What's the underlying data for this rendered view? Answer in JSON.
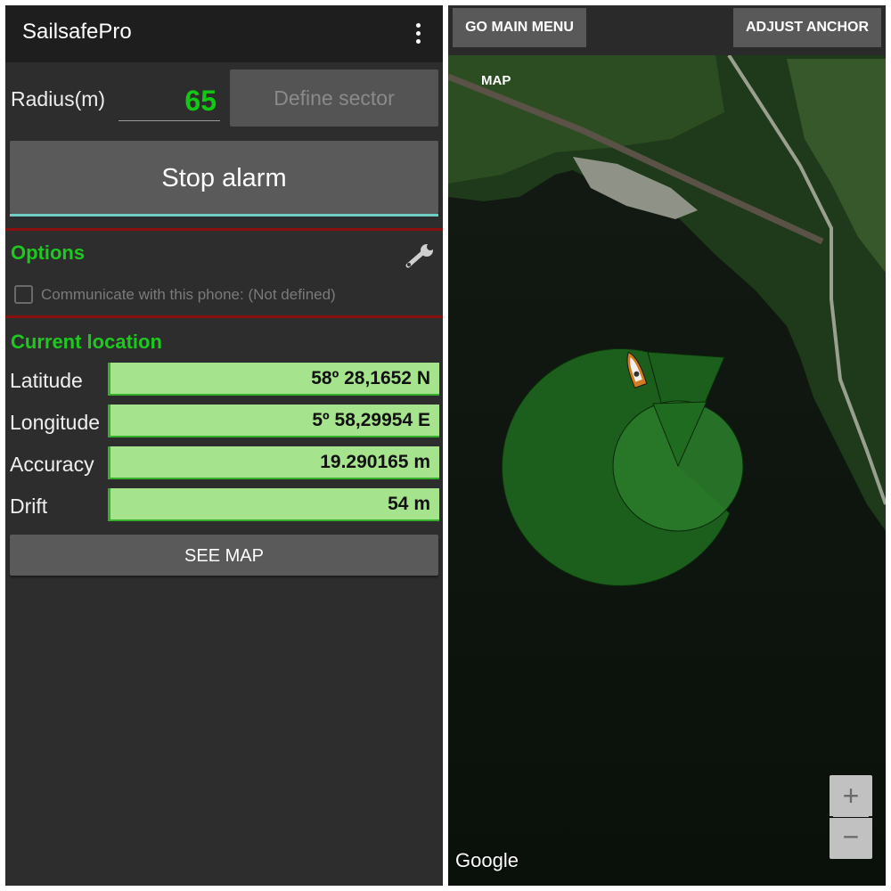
{
  "app": {
    "title": "SailsafePro",
    "overflow_icon": "more-vert-icon"
  },
  "radius": {
    "label": "Radius(m)",
    "value": "65",
    "value_color": "#12c812"
  },
  "define_sector_label": "Define sector",
  "stop_alarm_label": "Stop alarm",
  "options": {
    "title": "Options",
    "settings_icon": "wrench-icon",
    "communicate": {
      "label": "Communicate with this phone: (Not defined)",
      "checked": false
    }
  },
  "current_location": {
    "title": "Current location",
    "rows": [
      {
        "label": "Latitude",
        "value": "58º 28,1652 N"
      },
      {
        "label": "Longitude",
        "value": "5º 58,29954 E"
      },
      {
        "label": "Accuracy",
        "value": "19.290165 m"
      },
      {
        "label": "Drift",
        "value": "54 m"
      }
    ]
  },
  "see_map_label": "SEE MAP",
  "map": {
    "go_main_menu_label": "GO MAIN MENU",
    "adjust_anchor_label": "ADJUST ANCHOR",
    "map_label": "MAP",
    "attribution": "Google",
    "zoom_in_label": "+",
    "zoom_out_label": "−",
    "anchor_zone_color": "#1f6b1f",
    "boat_icon": "boat-icon"
  },
  "colors": {
    "accent_green": "#1ec81e",
    "separator_red": "#8a1010",
    "value_bg": "#a6e38d"
  }
}
